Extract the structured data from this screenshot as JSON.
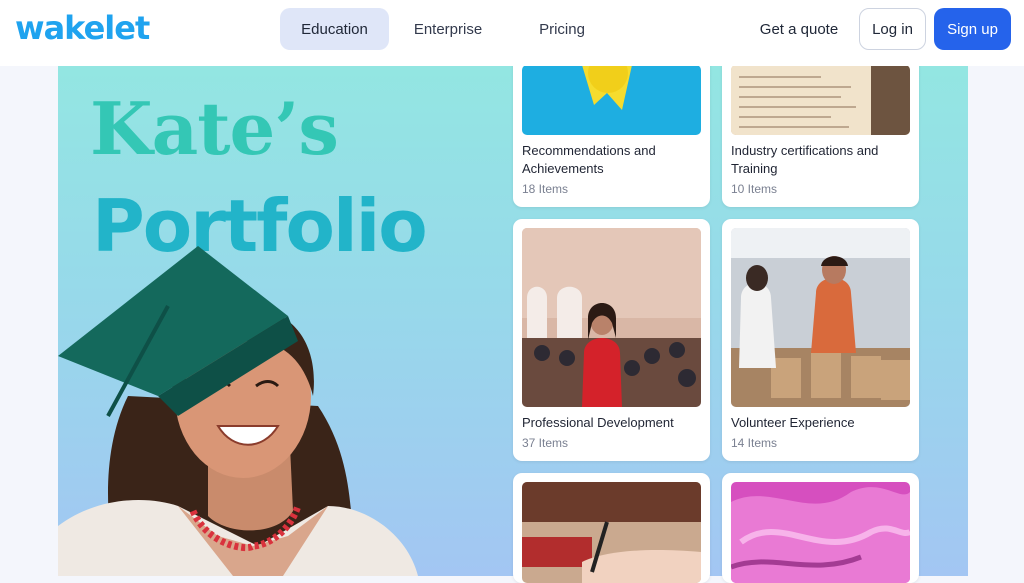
{
  "brand": {
    "logo": "wakelet",
    "color": "#1fa3ef"
  },
  "nav": {
    "tabs": [
      {
        "label": "Education",
        "active": true
      },
      {
        "label": "Enterprise",
        "active": false
      },
      {
        "label": "Pricing",
        "active": false
      }
    ],
    "quote_label": "Get a quote",
    "login_label": "Log in",
    "signup_label": "Sign up"
  },
  "portfolio": {
    "title_line1": "Kate’s",
    "title_line2": "Portfolio"
  },
  "collections": [
    {
      "title": "Recommendations and Achievements",
      "count": "18 Items"
    },
    {
      "title": "Industry certifications and Training",
      "count": "10 Items"
    },
    {
      "title": "Professional Development",
      "count": "37 Items"
    },
    {
      "title": "Volunteer Experience",
      "count": "14 Items"
    },
    {
      "title": "",
      "count": ""
    },
    {
      "title": "",
      "count": ""
    }
  ],
  "colors": {
    "accent": "#2563eb",
    "title_teal": "#34c7b5",
    "title_cyan": "#22b4c9"
  }
}
